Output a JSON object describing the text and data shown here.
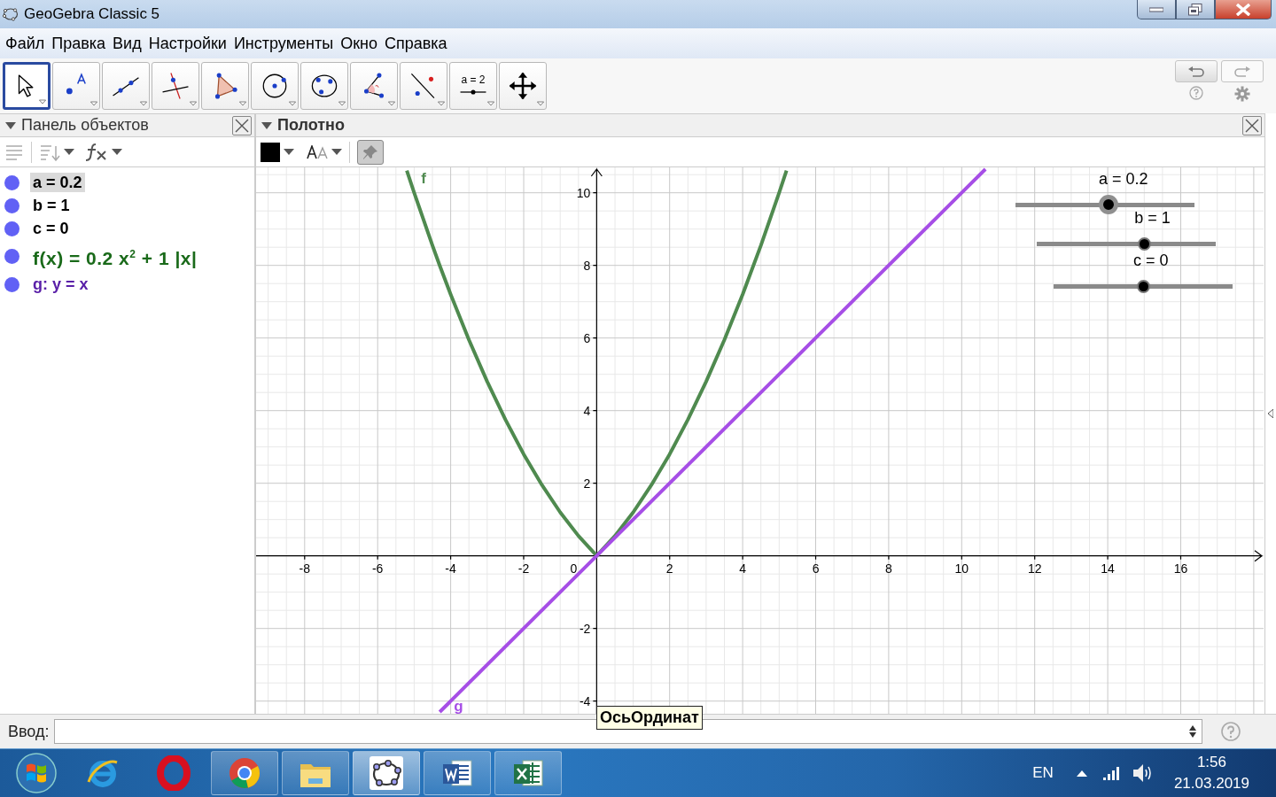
{
  "window": {
    "title": "GeoGebra Classic 5"
  },
  "menu": [
    "Файл",
    "Правка",
    "Вид",
    "Настройки",
    "Инструменты",
    "Окно",
    "Справка"
  ],
  "tools": [
    {
      "kind": "move",
      "selected": true
    },
    {
      "kind": "point",
      "selected": false
    },
    {
      "kind": "line",
      "selected": false
    },
    {
      "kind": "perpendicular",
      "selected": false
    },
    {
      "kind": "polygon",
      "selected": false
    },
    {
      "kind": "circle",
      "selected": false
    },
    {
      "kind": "conic",
      "selected": false
    },
    {
      "kind": "angle",
      "selected": false
    },
    {
      "kind": "reflect",
      "selected": false
    },
    {
      "kind": "slider",
      "selected": false,
      "text": "a = 2"
    },
    {
      "kind": "pan",
      "selected": false
    }
  ],
  "algebra": {
    "title": "Панель объектов",
    "items": [
      {
        "text": "a = 0.2",
        "color": "#000000",
        "selected": true
      },
      {
        "text": "b = 1",
        "color": "#000000",
        "selected": false
      },
      {
        "text": "c = 0",
        "color": "#000000",
        "selected": false
      },
      {
        "text": "f(x) = 0.2 x$^{2}$ + 1 |x|",
        "color": "#1a6a1a",
        "selected": false
      },
      {
        "text": "g: y = x",
        "color": "#5a20a8",
        "selected": false
      }
    ]
  },
  "graphics": {
    "title": "Полотно",
    "chart_data": {
      "type": "line",
      "x": [
        -5.2,
        -5,
        -4.5,
        -4.3,
        -4,
        -3.5,
        -3,
        -2.5,
        -2,
        -1.5,
        -1,
        -0.5,
        0,
        0.5,
        1,
        1.5,
        2,
        2.5,
        3,
        3.5,
        4,
        4.5,
        5,
        5.2,
        6,
        7,
        8,
        9,
        10,
        10.65
      ],
      "series": [
        {
          "name": "f",
          "color": "#4f8a4f",
          "values": [
            10.61,
            10,
            8.55,
            8,
            7.2,
            5.95,
            4.8,
            3.75,
            2.8,
            1.95,
            1.2,
            0.55,
            0,
            0.55,
            1.2,
            1.95,
            2.8,
            3.75,
            4.8,
            5.95,
            7.2,
            8.55,
            10,
            10.61,
            null,
            null,
            null,
            null,
            null,
            null
          ]
        },
        {
          "name": "g",
          "color": "#a64ee6",
          "values": [
            null,
            null,
            null,
            -4.3,
            -4,
            -3.5,
            -3,
            -2.5,
            -2,
            -1.5,
            -1,
            -0.5,
            0,
            0.5,
            1,
            1.5,
            2,
            2.5,
            3,
            3.5,
            4,
            4.5,
            5,
            5.2,
            6,
            7,
            8,
            9,
            10,
            10.65
          ]
        }
      ],
      "xlim": [
        -9.33,
        18.27
      ],
      "ylim": [
        -4.35,
        10.7
      ],
      "xticks": [
        -8,
        -6,
        -4,
        -2,
        2,
        4,
        6,
        8,
        10,
        12,
        14,
        16
      ],
      "yticks": [
        -4,
        -2,
        2,
        4,
        6,
        8,
        10
      ],
      "grid": true
    },
    "origin_label": "0",
    "sliders": [
      {
        "label": "a = 0.2",
        "level": 0.52,
        "selected": true
      },
      {
        "label": "b = 1",
        "level": 0.6,
        "selected": false
      },
      {
        "label": "c = 0",
        "level": 0.5,
        "selected": false
      }
    ],
    "tooltip": "ОсьОрдинат"
  },
  "input_bar": {
    "label": "Ввод:"
  },
  "taskbar": {
    "apps": [
      {
        "kind": "ie",
        "open": false,
        "selected": false
      },
      {
        "kind": "opera",
        "open": false,
        "selected": false
      },
      {
        "kind": "chrome",
        "open": true,
        "selected": false
      },
      {
        "kind": "explorer",
        "open": true,
        "selected": false
      },
      {
        "kind": "geogebra",
        "open": true,
        "selected": true
      },
      {
        "kind": "word",
        "open": true,
        "selected": false
      },
      {
        "kind": "excel",
        "open": true,
        "selected": false
      }
    ],
    "language": "EN",
    "time": "1:56",
    "date": "21.03.2019"
  }
}
